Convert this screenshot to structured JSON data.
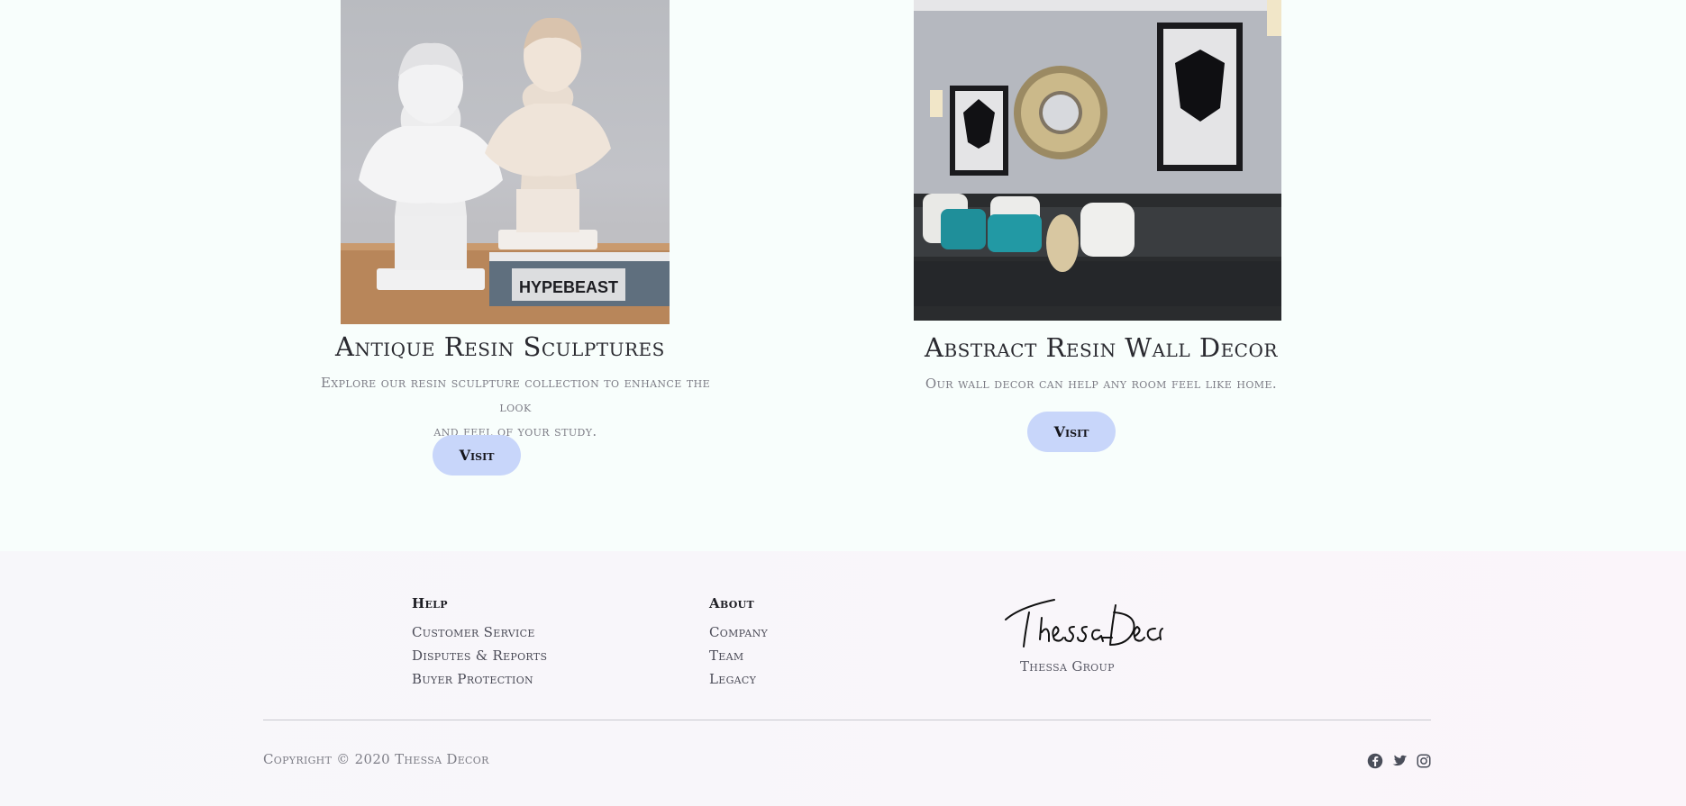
{
  "products": [
    {
      "title": "Antique Resin Sculptures",
      "description_line1": "Explore our resin sculpture collection to enhance the look",
      "description_line2": "and feel of your study.",
      "image_label": "HYPEBEAST",
      "button_label": "Visit"
    },
    {
      "title": "Abstract Resin Wall Decor",
      "description_line1": "Our wall decor can help any room feel like home.",
      "button_label": "Visit"
    }
  ],
  "footer": {
    "help": {
      "heading": "Help",
      "links": [
        "Customer Service",
        "Disputes & Reports",
        "Buyer Protection"
      ]
    },
    "about": {
      "heading": "About",
      "links": [
        "Company",
        "Team",
        "Legacy"
      ]
    },
    "brand": {
      "logo_text": "Thessa Decor",
      "subtitle": "Thessa Group"
    },
    "copyright": "Copyright © 2020 Thessa Decor",
    "social_icons": [
      "facebook-icon",
      "twitter-icon",
      "instagram-icon"
    ]
  },
  "colors": {
    "page_bg": "#f8fefc",
    "button_bg": "#c8d6fa",
    "footer_bg": "#f8f7fa",
    "text_dark": "#2a2a30",
    "text_muted": "#7d7d86"
  }
}
